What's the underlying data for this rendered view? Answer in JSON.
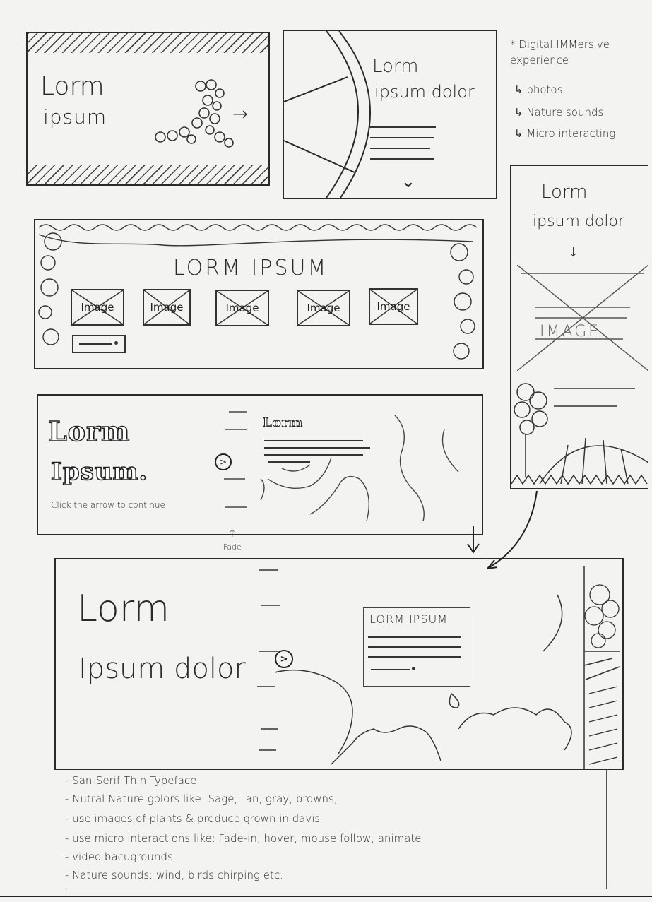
{
  "frame1": {
    "line1": "Lorm",
    "line2": "ipsum",
    "arrow": "→"
  },
  "frame2": {
    "line1": "Lorm",
    "line2": "ipsum dolor",
    "chevron": "⌄"
  },
  "notes_top": {
    "title": "* Digital IMMersive experience",
    "items": [
      "↳ photos",
      "↳ Nature sounds",
      "↳ Micro interacting"
    ]
  },
  "frame3": {
    "title": "LORM IPSUM",
    "images": [
      "Image",
      "Image",
      "Image",
      "Image",
      "Image"
    ]
  },
  "frame_side": {
    "line1": "Lorm",
    "line2": "ipsum dolor",
    "image_label": "IMAGE",
    "arrow": "↓"
  },
  "frame4": {
    "line1": "Lorm",
    "line2": "Ipsum.",
    "caption": "Click the arrow to continue",
    "card_title": "Lorm",
    "fade_label": "Fade"
  },
  "frame5": {
    "line1": "Lorm",
    "line2": "Ipsum dolor",
    "card_title": "LORM IPSUM"
  },
  "notes_bottom": [
    "- San-Serif Thin Typeface",
    "- Nutral Nature golors like: Sage, Tan, gray, browns,",
    "- use images of plants & produce grown in davis",
    "- use micro interactions like: Fade-in, hover, mouse follow, animate",
    "- video bacugrounds",
    "- Nature sounds: wind, birds chirping etc."
  ]
}
